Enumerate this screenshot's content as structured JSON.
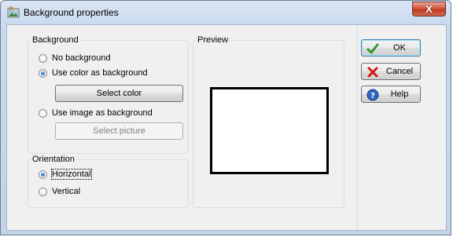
{
  "window": {
    "title": "Background properties",
    "close_label": "X"
  },
  "background_group": {
    "legend": "Background",
    "options": [
      "No background",
      "Use color as background",
      "Use image as background"
    ],
    "selected": 1,
    "select_color_label": "Select color",
    "select_picture_label": "Select picture"
  },
  "orientation_group": {
    "legend": "Orientation",
    "options": [
      "Horizontal",
      "Vertical"
    ],
    "selected": 0
  },
  "preview_group": {
    "legend": "Preview",
    "fill_color": "#ffffff"
  },
  "buttons": {
    "ok": "OK",
    "cancel": "Cancel",
    "help": "Help"
  }
}
